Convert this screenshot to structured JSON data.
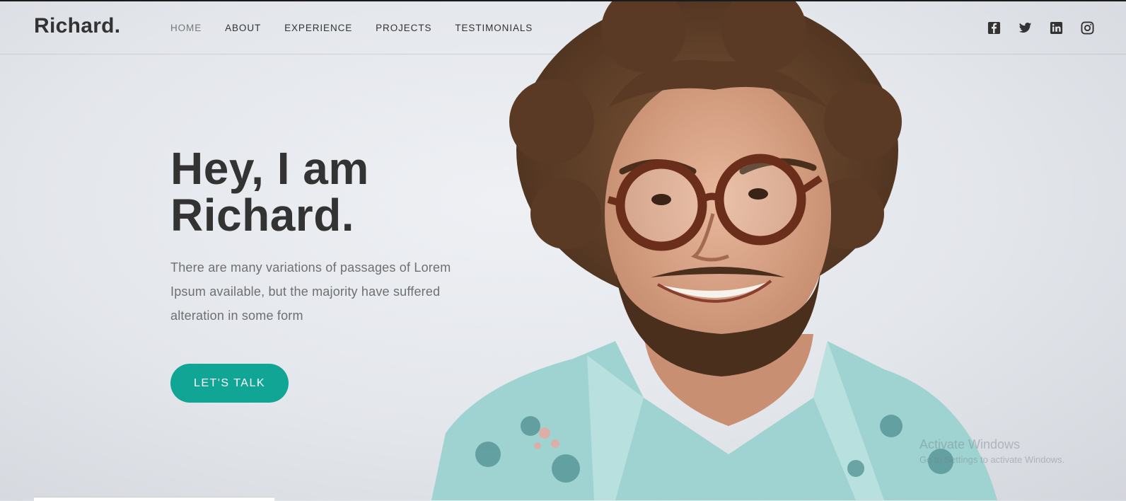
{
  "brand": {
    "logo": "Richard."
  },
  "nav": {
    "items": [
      {
        "label": "HOME"
      },
      {
        "label": "ABOUT"
      },
      {
        "label": "EXPERIENCE"
      },
      {
        "label": "PROJECTS"
      },
      {
        "label": "TESTIMONIALS"
      }
    ]
  },
  "social": {
    "icons": [
      "facebook-icon",
      "twitter-icon",
      "linkedin-icon",
      "instagram-icon"
    ]
  },
  "hero": {
    "title_line1": "Hey, I am",
    "title_line2": "Richard.",
    "description": "There are many variations of passages of Lorem Ipsum available, but the majority have suffered alteration in some form",
    "cta_label": "LET'S TALK"
  },
  "os_watermark": {
    "line1": "Activate Windows",
    "line2": "Go to Settings to activate Windows."
  },
  "colors": {
    "accent": "#10a594",
    "text_dark": "#333333",
    "text_muted": "#6f6f6f",
    "background": "#e3e6eb"
  }
}
